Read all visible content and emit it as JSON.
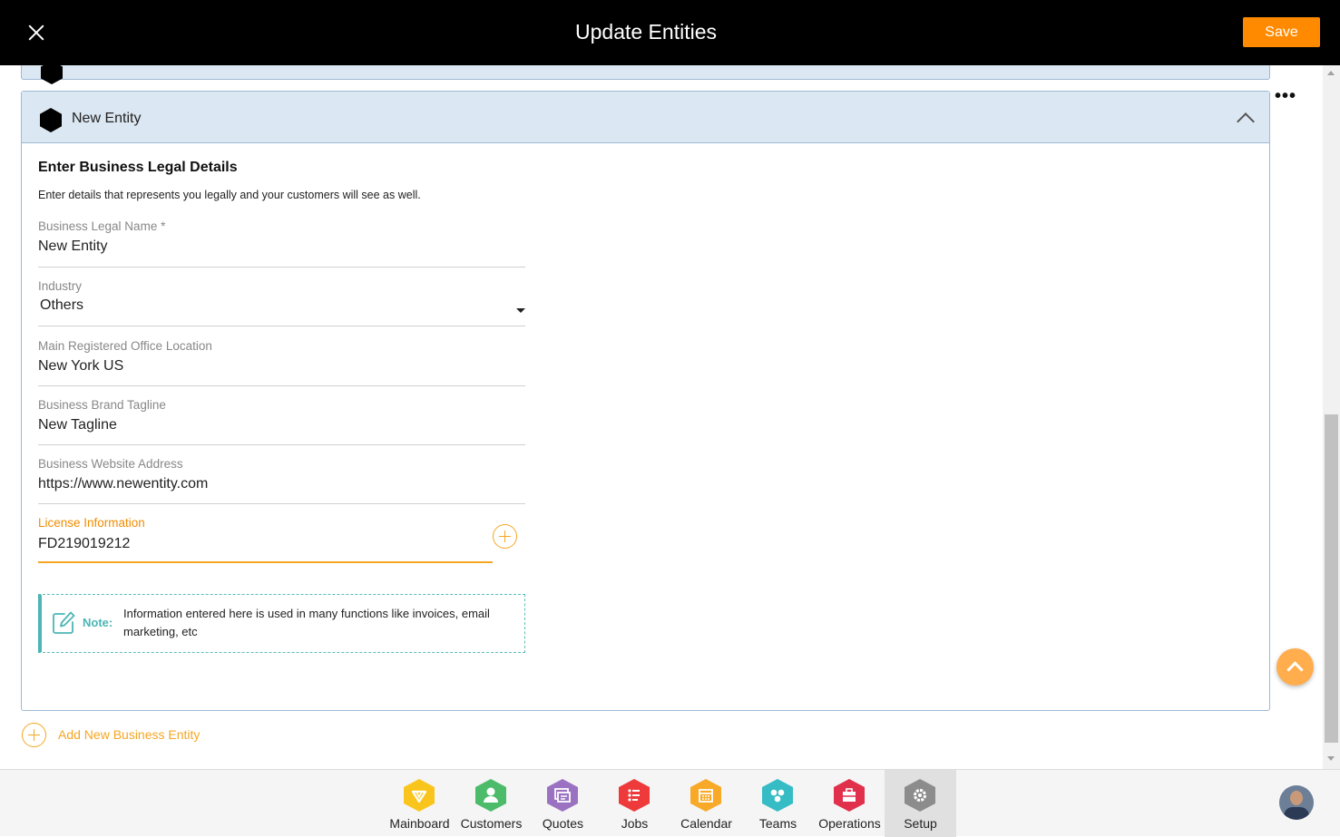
{
  "header": {
    "title": "Update Entities",
    "save_label": "Save"
  },
  "entity": {
    "name": "New Entity",
    "section_title": "Enter Business Legal Details",
    "section_desc": "Enter details that represents you legally and your customers will see as well."
  },
  "fields": {
    "legal_name": {
      "label": "Business Legal Name",
      "required_mark": "*",
      "value": "New Entity"
    },
    "industry": {
      "label": "Industry",
      "value": "Others"
    },
    "office_location": {
      "label": "Main Registered Office Location",
      "value": "New York US"
    },
    "tagline": {
      "label": "Business Brand Tagline",
      "value": "New Tagline"
    },
    "website": {
      "label": "Business Website Address",
      "value": "https://www.newentity.com"
    },
    "license": {
      "label": "License Information",
      "value": "FD219019212"
    }
  },
  "note": {
    "label": "Note:",
    "text": "Information entered here is used in many functions like invoices, email marketing, etc"
  },
  "add_entity_label": "Add New Business Entity",
  "more_label": "•••",
  "bottom_nav": {
    "items": [
      {
        "label": "Mainboard",
        "color": "#f9c51d",
        "icon": "mainboard-icon"
      },
      {
        "label": "Customers",
        "color": "#4cbb6a",
        "icon": "customers-icon"
      },
      {
        "label": "Quotes",
        "color": "#9b72c2",
        "icon": "quotes-icon"
      },
      {
        "label": "Jobs",
        "color": "#ee3a3a",
        "icon": "jobs-icon"
      },
      {
        "label": "Calendar",
        "color": "#f8a928",
        "icon": "calendar-icon"
      },
      {
        "label": "Teams",
        "color": "#36bcc4",
        "icon": "teams-icon"
      },
      {
        "label": "Operations",
        "color": "#e0304c",
        "icon": "operations-icon"
      },
      {
        "label": "Setup",
        "color": "#8c8c8c",
        "icon": "setup-icon"
      }
    ],
    "active": "Setup"
  },
  "colors": {
    "accent": "#ff8a00",
    "header_bg": "#000000",
    "entity_header_bg": "#dbe7f2",
    "note_accent": "#4cb5b5"
  }
}
